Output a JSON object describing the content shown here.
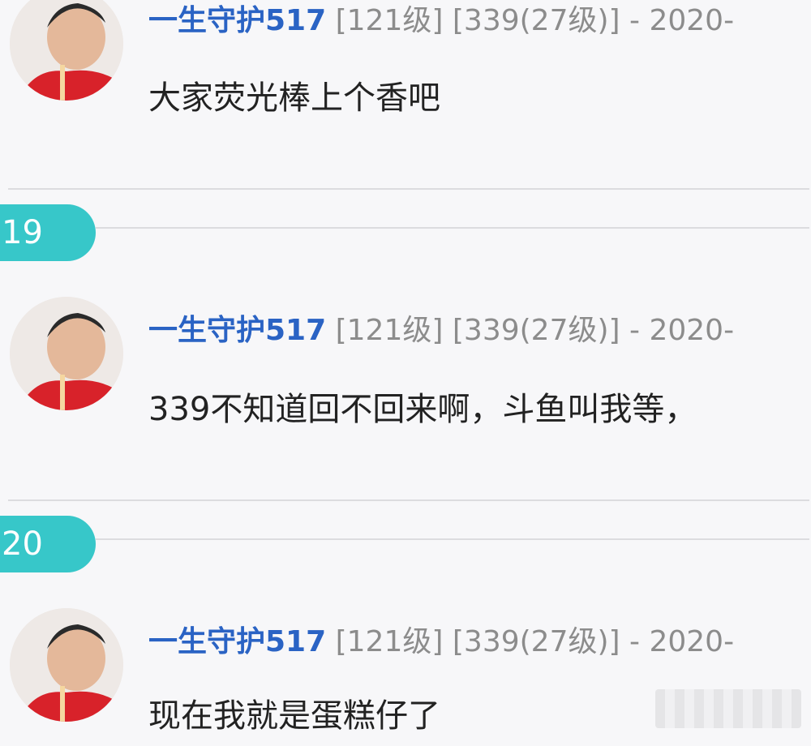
{
  "posts": [
    {
      "username": "一生守护517",
      "level_tag": "[121级]",
      "fan_tag": "[339(27级)]",
      "date_tag": "- 2020-",
      "content": "大家荧光棒上个香吧"
    },
    {
      "floor": "19",
      "username": "一生守护517",
      "level_tag": "[121级]",
      "fan_tag": "[339(27级)]",
      "date_tag": "- 2020-",
      "content": "339不知道回不回来啊，斗鱼叫我等，"
    },
    {
      "floor": "20",
      "username": "一生守护517",
      "level_tag": "[121级]",
      "fan_tag": "[339(27级)]",
      "date_tag": "- 2020-",
      "content": "现在我就是蛋糕仔了"
    }
  ],
  "colors": {
    "username": "#2a63c4",
    "tag": "#8c8c8c",
    "floor_badge": "#37c7c9",
    "divider": "#dcdcdf",
    "background": "#f7f7f9"
  },
  "icons": {
    "avatar": "user-avatar-icon"
  }
}
